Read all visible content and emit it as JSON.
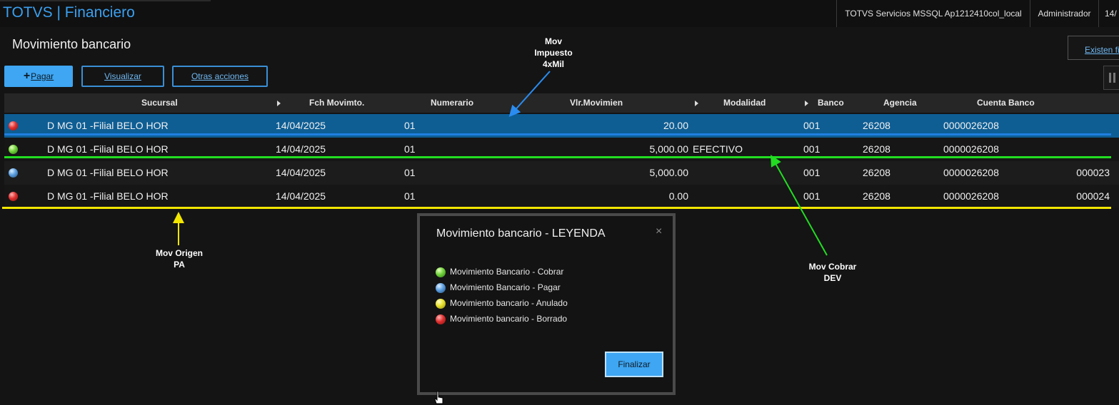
{
  "app": {
    "title": "TOTVS | Financiero"
  },
  "topbar": {
    "server": "TOTVS Servicios MSSQL Ap1212410col_local",
    "user": "Administrador",
    "date": "14/"
  },
  "page": {
    "title": "Movimiento bancario",
    "filter_link": "Existen fi",
    "buttons": {
      "pagar": "Pagar",
      "visualizar": "Visualizar",
      "otras": "Otras acciones"
    }
  },
  "grid": {
    "columns": [
      "Sucursal",
      "Fch Movimto.",
      "Numerario",
      "Vlr.Movimien",
      "Modalidad",
      "Banco",
      "Agencia",
      "Cuenta Banco"
    ],
    "rows": [
      {
        "status": "red",
        "sucursal": "D MG 01 -Filial BELO HOR",
        "fecha": "14/04/2025",
        "numerario": "01",
        "valor": "20.00",
        "modalidad": "",
        "banco": "001",
        "agencia": "26208",
        "cuenta": "0000026208",
        "extra": ""
      },
      {
        "status": "green",
        "sucursal": "D MG 01 -Filial BELO HOR",
        "fecha": "14/04/2025",
        "numerario": "01",
        "valor": "5,000.00",
        "modalidad": "EFECTIVO",
        "banco": "001",
        "agencia": "26208",
        "cuenta": "0000026208",
        "extra": ""
      },
      {
        "status": "blue",
        "sucursal": "D MG 01 -Filial BELO HOR",
        "fecha": "14/04/2025",
        "numerario": "01",
        "valor": "5,000.00",
        "modalidad": "",
        "banco": "001",
        "agencia": "26208",
        "cuenta": "0000026208",
        "extra": "000023"
      },
      {
        "status": "red",
        "sucursal": "D MG 01 -Filial BELO HOR",
        "fecha": "14/04/2025",
        "numerario": "01",
        "valor": "0.00",
        "modalidad": "",
        "banco": "001",
        "agencia": "26208",
        "cuenta": "0000026208",
        "extra": "000024"
      }
    ]
  },
  "annotations": {
    "impuesto": [
      "Mov",
      "Impuesto",
      "4xMil"
    ],
    "origen": [
      "Mov Origen",
      "PA"
    ],
    "cobrar": [
      "Mov Cobrar",
      "DEV"
    ]
  },
  "legend": {
    "title": "Movimiento bancario - LEYENDA",
    "close": "×",
    "items": [
      {
        "status": "green",
        "label": "Movimiento Bancario - Cobrar"
      },
      {
        "status": "blue",
        "label": "Movimiento Bancario - Pagar"
      },
      {
        "status": "yellow",
        "label": "Movimiento bancario - Anulado"
      },
      {
        "status": "red",
        "label": "Movimiento bancario - Borrado"
      }
    ],
    "button": "Finalizar"
  },
  "colors": {
    "accent": "#3ea6f2",
    "selected_row": "#0e5e94",
    "line_blue": "#1f7fe0",
    "line_green": "#22dd22",
    "line_yellow": "#f2e600"
  }
}
